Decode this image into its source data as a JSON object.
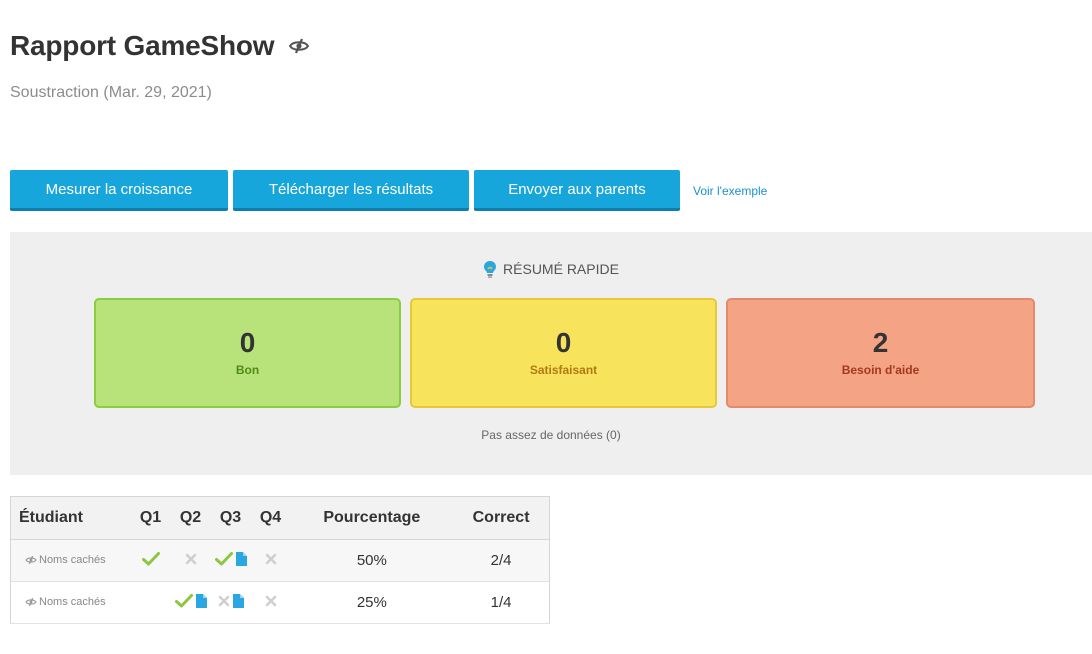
{
  "header": {
    "title": "Rapport GameShow",
    "subtitle": "Soustraction (Mar. 29, 2021)"
  },
  "actions": {
    "growth_label": "Mesurer la croissance",
    "download_label": "Télécharger les résultats",
    "parents_label": "Envoyer aux parents",
    "example_link": "Voir l'exemple"
  },
  "summary": {
    "heading": "RÉSUMÉ RAPIDE",
    "good": {
      "count": "0",
      "label": "Bon"
    },
    "ok": {
      "count": "0",
      "label": "Satisfaisant"
    },
    "help": {
      "count": "2",
      "label": "Besoin d'aide"
    },
    "no_data": "Pas assez de données (0)"
  },
  "table": {
    "headers": [
      "Étudiant",
      "Q1",
      "Q2",
      "Q3",
      "Q4",
      "Pourcentage",
      "Correct"
    ],
    "rows": [
      {
        "student": "Noms cachés",
        "q1": [
          "check-icon"
        ],
        "q2": [
          "cross-icon"
        ],
        "q3": [
          "check-icon",
          "note-icon"
        ],
        "q4": [
          "cross-icon"
        ],
        "percent": "50%",
        "correct": "2/4"
      },
      {
        "student": "Noms cachés",
        "q1": [],
        "q2": [
          "check-icon",
          "note-icon"
        ],
        "q3": [
          "cross-icon",
          "note-icon"
        ],
        "q4": [
          "cross-icon"
        ],
        "percent": "25%",
        "correct": "1/4"
      }
    ]
  },
  "colors": {
    "button": "#16a6dc",
    "good": "#b8e27a",
    "ok": "#f8e45c",
    "help": "#f4a385",
    "check": "#8dc63f",
    "cross": "#cfcfcf",
    "note": "#2aa7e0"
  }
}
